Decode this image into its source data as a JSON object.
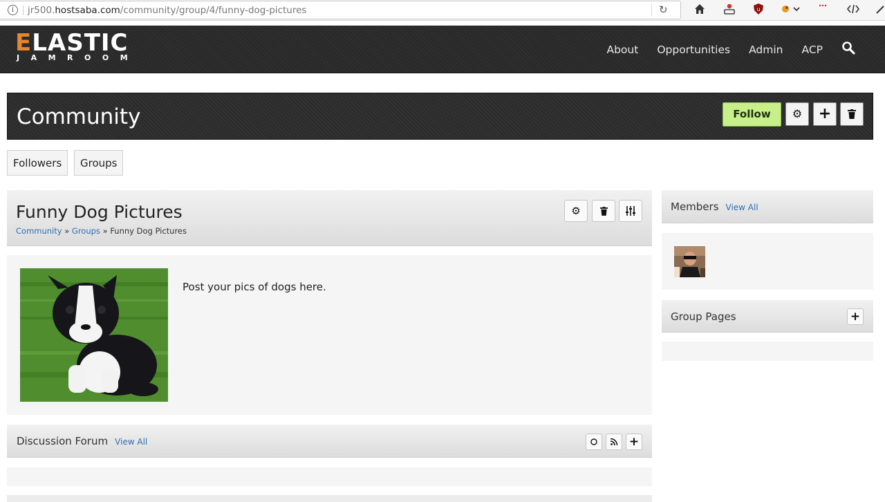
{
  "browser": {
    "url_prefix": "jr500.",
    "url_domain": "hostsaba.com",
    "url_path": "/community/group/4/funny-dog-pictures",
    "reload_icon": "reload-icon",
    "toolbar_icons": [
      "home-icon",
      "profile-icon",
      "ublock-icon",
      "extension-icon",
      "devtools-icon"
    ]
  },
  "site": {
    "logo_main": "ELASTIC",
    "logo_sub": "JAMROOM",
    "accent": "#e8862c",
    "nav": [
      "About",
      "Opportunities",
      "Admin",
      "ACP"
    ]
  },
  "banner": {
    "title": "Community",
    "follow_label": "Follow",
    "follow_color": "#c8f08a"
  },
  "tabs": [
    "Followers",
    "Groups"
  ],
  "group": {
    "title": "Funny Dog Pictures",
    "crumbs": [
      "Community",
      "Groups",
      "Funny Dog Pictures"
    ],
    "crumb_sep": "»",
    "description": "Post your pics of dogs here."
  },
  "forum": {
    "title": "Discussion Forum",
    "view_all": "View All"
  },
  "members": {
    "title": "Members",
    "view_all": "View All"
  },
  "group_pages": {
    "title": "Group Pages"
  }
}
